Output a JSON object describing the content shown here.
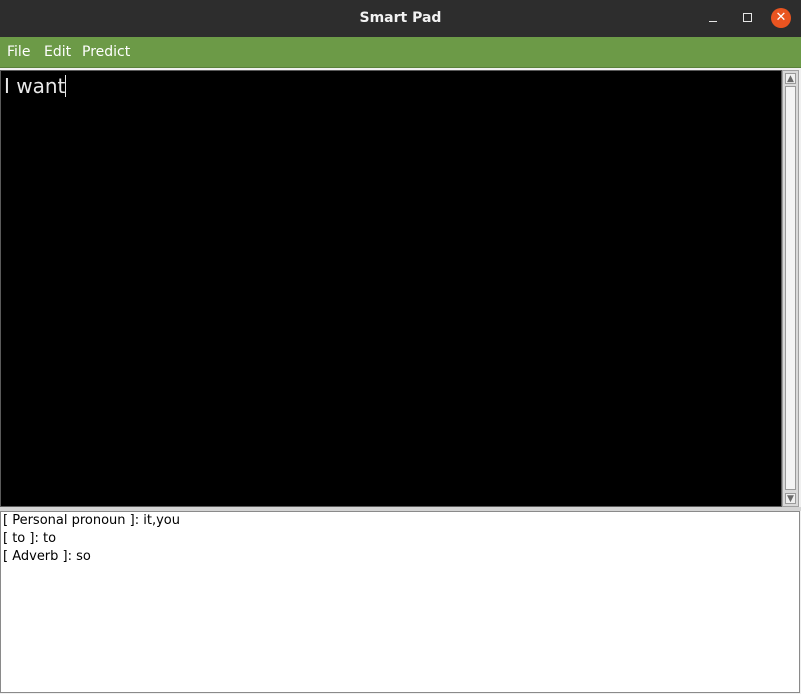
{
  "window": {
    "title": "Smart Pad",
    "minimize_icon": "minimize-icon",
    "maximize_icon": "maximize-icon",
    "close_icon": "close-icon",
    "close_symbol": "✕"
  },
  "menubar": {
    "items": [
      {
        "label": "File"
      },
      {
        "label": "Edit"
      },
      {
        "label": "Predict"
      }
    ],
    "background": "#6c9a47"
  },
  "editor": {
    "text": "I want",
    "background": "#000000",
    "text_color": "#e8e8e8"
  },
  "predictions": {
    "lines": [
      "[ Personal pronoun ]: it,you",
      "[ to ]: to",
      "[ Adverb ]: so"
    ]
  },
  "colors": {
    "titlebar": "#2d2d2d",
    "close_button": "#e95420"
  }
}
